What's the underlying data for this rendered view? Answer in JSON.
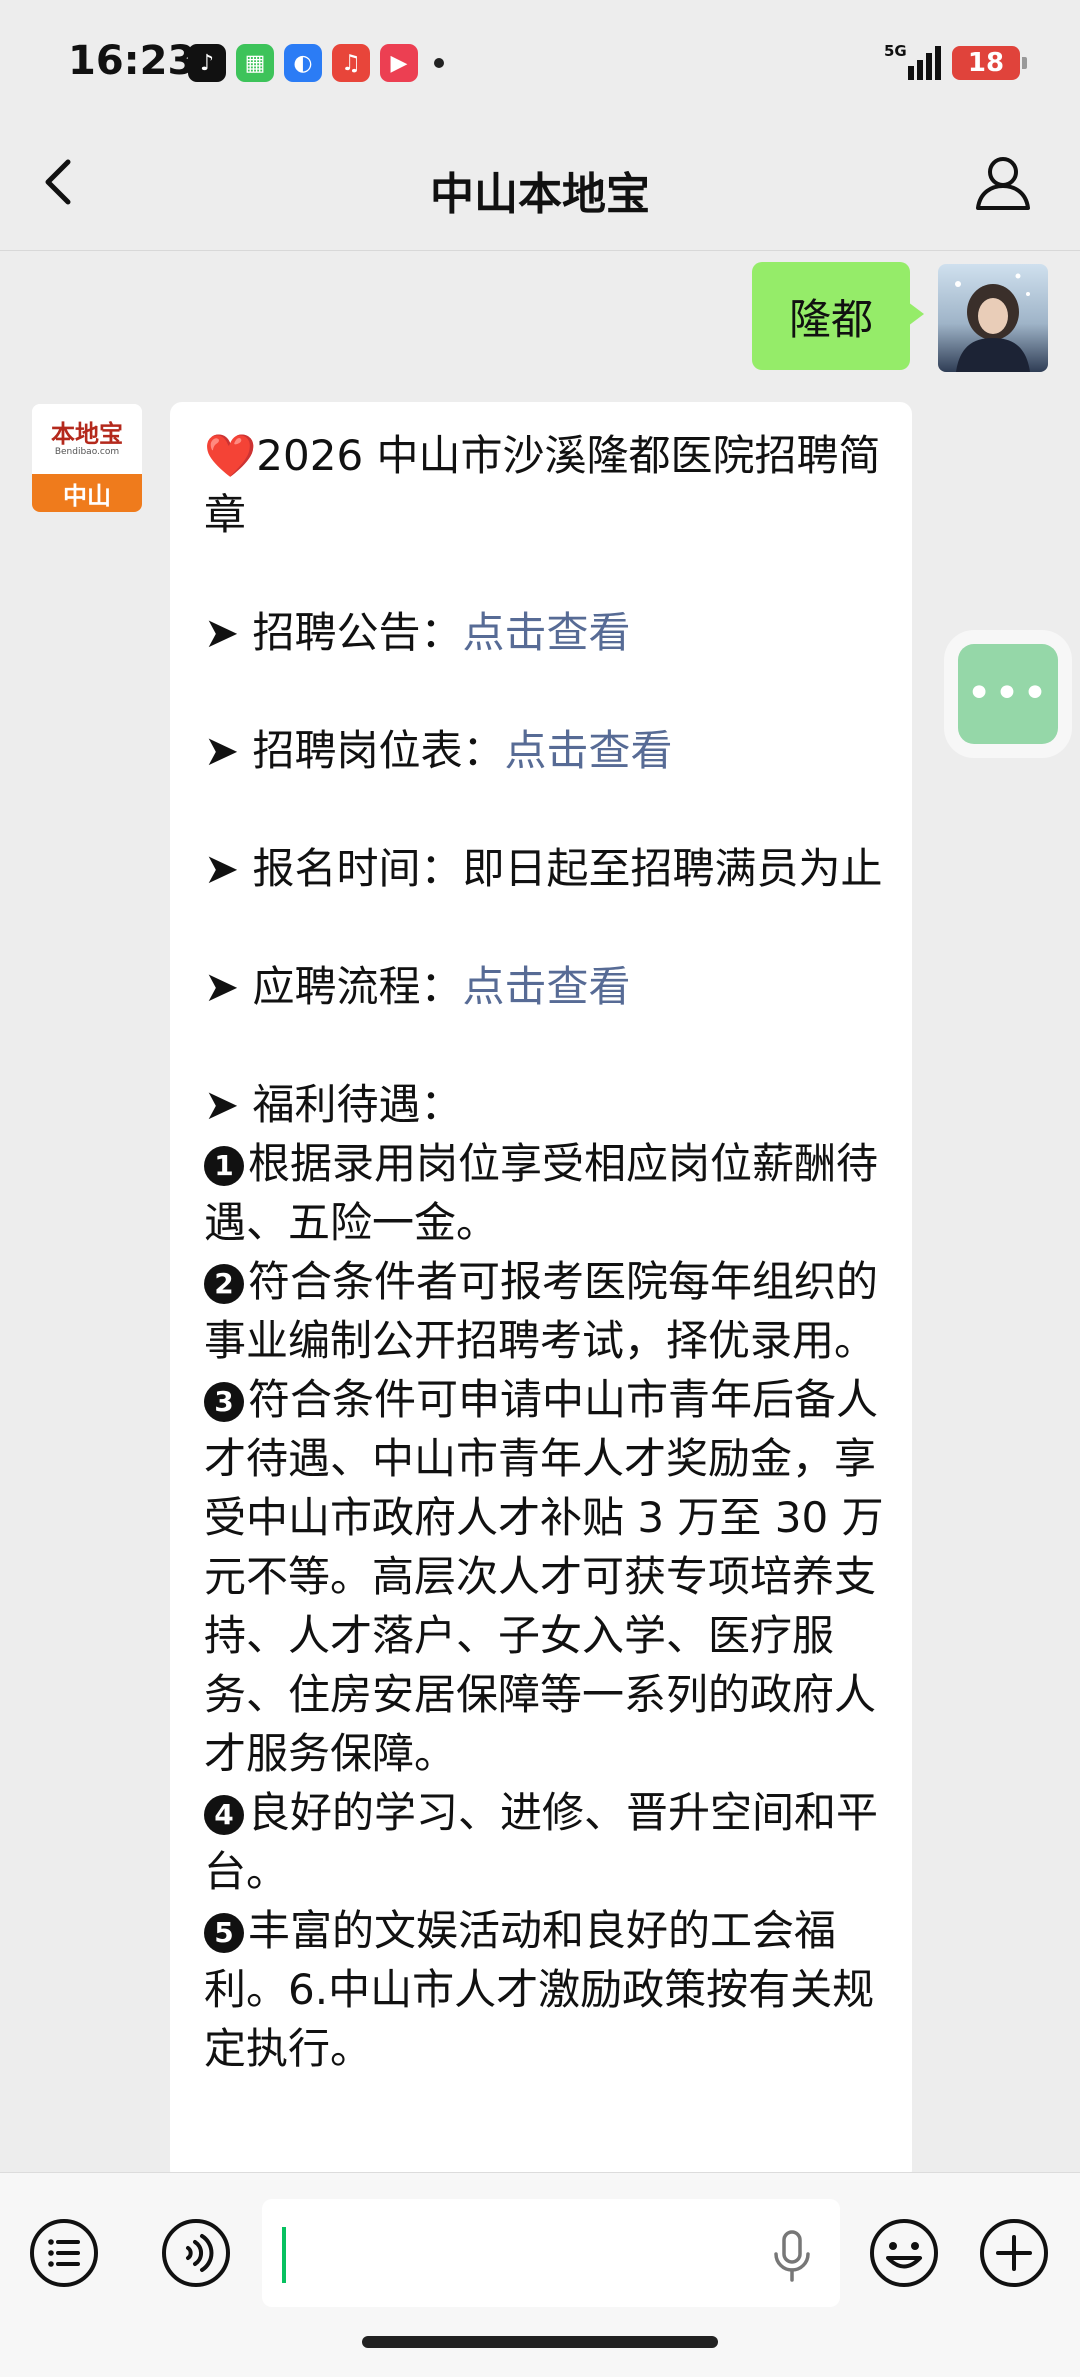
{
  "status_bar": {
    "time": "16:23",
    "network": "5G",
    "battery": "18"
  },
  "nav": {
    "title": "中山本地宝"
  },
  "outgoing_message": {
    "text": "隆都"
  },
  "bot_avatar": {
    "brand": "本地宝",
    "site": "Bendibao.com",
    "city": "中山"
  },
  "incoming_message": {
    "title": "❤️2026 中山市沙溪隆都医院招聘简章",
    "items": [
      {
        "label": "➤ 招聘公告：",
        "link": "点击查看"
      },
      {
        "label": "➤ 招聘岗位表：",
        "link": "点击查看"
      },
      {
        "label": "➤ 报名时间：即日起至招聘满员为止",
        "link": ""
      },
      {
        "label": "➤ 应聘流程：",
        "link": "点击查看"
      }
    ],
    "benefits_heading": "➤ 福利待遇：",
    "benefits": [
      {
        "num": "1",
        "text": "根据录用岗位享受相应岗位薪酬待遇、五险一金。"
      },
      {
        "num": "2",
        "text": "符合条件者可报考医院每年组织的事业编制公开招聘考试，择优录用。"
      },
      {
        "num": "3",
        "text": "符合条件可申请中山市青年后备人才待遇、中山市青年人才奖励金，享受中山市政府人才补贴 3 万至 30 万元不等。高层次人才可获专项培养支持、人才落户、子女入学、医疗服务、住房安居保障等一系列的政府人才服务保障。"
      },
      {
        "num": "4",
        "text": "良好的学习、进修、晋升空间和平台。"
      },
      {
        "num": "5",
        "text": "丰富的文娱活动和良好的工会福利。6.中山市人才激励政策按有关规定执行。"
      }
    ]
  },
  "input": {
    "value": ""
  }
}
